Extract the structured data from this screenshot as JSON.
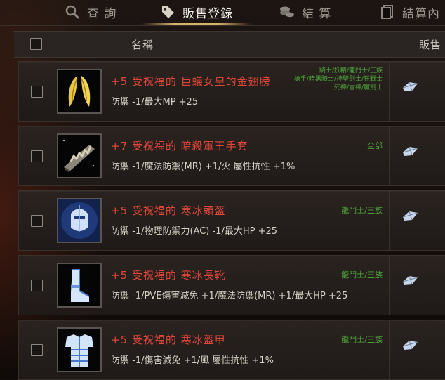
{
  "tabs": [
    {
      "label": "查 詢",
      "icon": "search-icon"
    },
    {
      "label": "販售登錄",
      "icon": "price-tag-icon"
    },
    {
      "label": "結 算",
      "icon": "coins-icon"
    },
    {
      "label": "結算內",
      "icon": "document-icon"
    }
  ],
  "header": {
    "name_col": "名稱",
    "sell_col": "販售"
  },
  "items": [
    {
      "name": "+5 受祝福的 巨蟻女皇的金翅膀",
      "stats": "防禦 -1/最大MP +25",
      "class_lines": [
        "騎士/妖精/龍鬥士/王族",
        "槍手/暗黑騎士/神聖劍士/狂戰士",
        "死神/雷神/魔劍士"
      ],
      "icon": "golden-wings-icon"
    },
    {
      "name": "+7 受祝福的 暗殺軍王手套",
      "stats": "防禦 -1/魔法防禦(MR) +1/火 屬性抗性 +1%",
      "class_lines": [
        "全部"
      ],
      "icon": "assassin-gloves-icon"
    },
    {
      "name": "+5 受祝福的 寒冰頭盔",
      "stats": "防禦 -1/物理防禦力(AC) -1/最大HP +25",
      "class_lines": [
        "龍鬥士/王族"
      ],
      "icon": "ice-helmet-icon"
    },
    {
      "name": "+5 受祝福的 寒冰長靴",
      "stats": "防禦 -1/PVE傷害減免 +1/魔法防禦(MR) +1/最大HP +25",
      "class_lines": [
        "龍鬥士/王族"
      ],
      "icon": "ice-boots-icon"
    },
    {
      "name": "+5 受祝福的 寒冰盔甲",
      "stats": "防禦 -1/傷害減免 +1/風 屬性抗性 +1%",
      "class_lines": [
        "龍鬥士/王族"
      ],
      "icon": "ice-armor-icon"
    }
  ],
  "colors": {
    "item_name": "#e0463a",
    "class_text": "#4fa83b",
    "tab_accent": "#d9b26a"
  }
}
